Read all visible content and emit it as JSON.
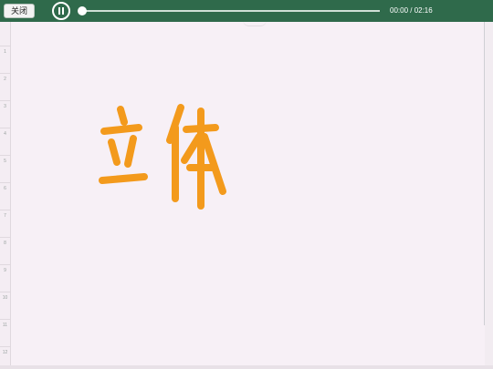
{
  "toolbar": {
    "close_label": "关闭",
    "time_display": "00:00 / 02:16",
    "progress": 0.0
  },
  "ruler": {
    "marks": [
      "1",
      "2",
      "3",
      "4",
      "5",
      "6",
      "7",
      "8",
      "9",
      "10",
      "11",
      "12"
    ]
  },
  "canvas": {
    "ink_text": "立体",
    "ink_color": "#f39a1c",
    "background_color": "#f7f0f6"
  },
  "colors": {
    "toolbar_bg": "#2f6a4b",
    "accent_white": "#ffffff"
  }
}
